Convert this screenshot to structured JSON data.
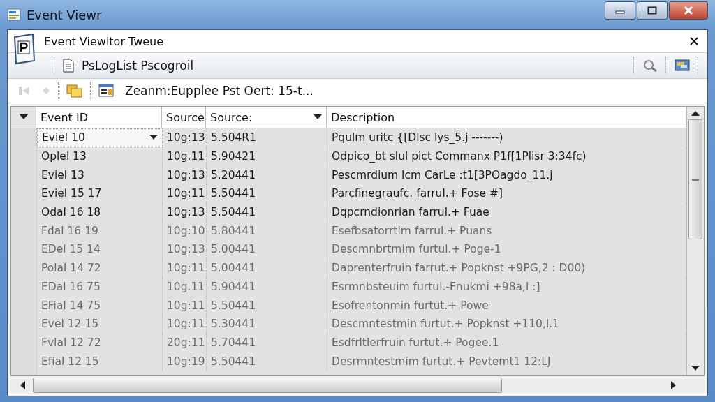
{
  "window": {
    "title": "Event Viewr"
  },
  "panel": {
    "title": "Event Viewltor Tweue"
  },
  "toolbar": {
    "label": "PsLogList Psсogroil"
  },
  "path_bar": {
    "back_disabled": true,
    "forward_disabled": true,
    "text": "Zeanm:Eupplee Pst Oert: 15-t..."
  },
  "table": {
    "columns": [
      "Event ID",
      "Source",
      "Source:",
      "Description"
    ],
    "rows": [
      {
        "selected": true,
        "dimmed": false,
        "cells": [
          "Eviel 10",
          "10g:13",
          "5.504R1",
          "Pqulm uritc {[Dlsc lys_5.j -------)"
        ]
      },
      {
        "selected": false,
        "dimmed": false,
        "cells": [
          "Oplel 13",
          "10g.11",
          "5.90421",
          "Odpico_bt slul pict Commanx P1f[1Plisr 3:34fc)"
        ]
      },
      {
        "selected": false,
        "dimmed": false,
        "cells": [
          "Eviel 13",
          "10g:13",
          "5.20441",
          "Pescmrdium lcm CarLe :t1[3POagdo_11.j"
        ]
      },
      {
        "selected": false,
        "dimmed": false,
        "cells": [
          "Eviel 15 17",
          "10g:11",
          "5.50441",
          "Parcfinegraufc. farrul.+ Fose #]"
        ]
      },
      {
        "selected": false,
        "dimmed": false,
        "cells": [
          "Odal 16 18",
          "10g:13",
          "5.50441",
          "Dqpcrndionrian farrul.+ Fuae"
        ]
      },
      {
        "selected": false,
        "dimmed": true,
        "cells": [
          "Fdal 16 19",
          "10g:10",
          "5.80441",
          "Esefbsatorrtim farrul.+ Puans"
        ]
      },
      {
        "selected": false,
        "dimmed": true,
        "cells": [
          "EDel 15 14",
          "10g:13",
          "5.00441",
          "Descmnbrtmim furtul.+ Poge-1"
        ]
      },
      {
        "selected": false,
        "dimmed": true,
        "cells": [
          "Polal 14 72",
          "10g:11",
          "5.00441",
          "Daprenterfruin farrut.+ Popknst +9PG,2 : D00)"
        ]
      },
      {
        "selected": false,
        "dimmed": true,
        "cells": [
          "EDal 16 75",
          "10g.11",
          "5.90441",
          "Esrmnbsteuim furtul.-Fnukmi +98a,l :]"
        ]
      },
      {
        "selected": false,
        "dimmed": true,
        "cells": [
          "EFial 14 75",
          "10g:11",
          "5.50441",
          "Esofrentonmin furtut.+ Powe"
        ]
      },
      {
        "selected": false,
        "dimmed": true,
        "cells": [
          "Evel 12 15",
          "10g:11",
          "5.30441",
          "Descmntestmin furtut.+ Popknst +110,l.1"
        ]
      },
      {
        "selected": false,
        "dimmed": true,
        "cells": [
          "Fvlal 12 72",
          "20g:11",
          "5.70441",
          "Esdfrltlerfruin furtut.+ Pogee.1"
        ]
      },
      {
        "selected": false,
        "dimmed": true,
        "cells": [
          "Efial 12 15",
          "10g:19",
          "5.50441",
          "Desrmntestmim furtut.+ Pevtemt1 12:LJ"
        ]
      }
    ]
  }
}
